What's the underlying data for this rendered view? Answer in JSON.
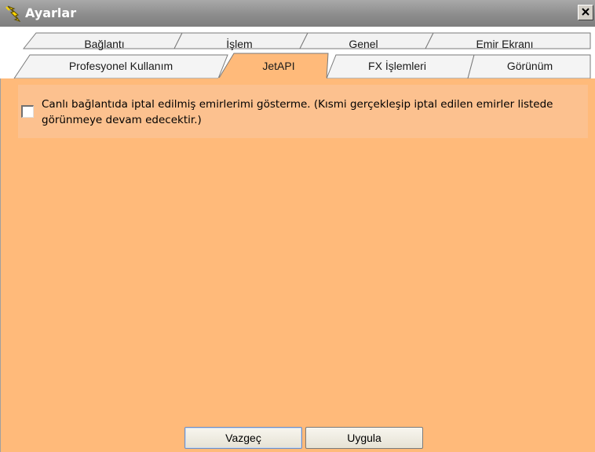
{
  "window": {
    "title": "Ayarlar",
    "close_symbol": "×"
  },
  "tabs": {
    "row_top": [
      {
        "label": "Bağlantı"
      },
      {
        "label": "İşlem"
      },
      {
        "label": "Genel"
      },
      {
        "label": "Emir Ekranı"
      }
    ],
    "row_bottom": [
      {
        "label": "Profesyonel Kullanım"
      },
      {
        "label": "JetAPI",
        "active": true
      },
      {
        "label": "FX İşlemleri"
      },
      {
        "label": "Görünüm"
      }
    ]
  },
  "options": {
    "hide_cancelled": {
      "checked": false,
      "text": "Canlı bağlantıda iptal edilmiş emirlerimi gösterme. (Kısmi gerçekleşip iptal edilen emirler listede görünmeye devam edecektir.)"
    }
  },
  "buttons": {
    "cancel": "Vazgeç",
    "apply": "Uygula"
  },
  "colors": {
    "panel_bg": "#ffba7a",
    "option_bg": "#fcc18f",
    "titlebar": "#8d8d8d"
  },
  "icons": {
    "title": "lightning-icon",
    "close": "close-icon"
  }
}
